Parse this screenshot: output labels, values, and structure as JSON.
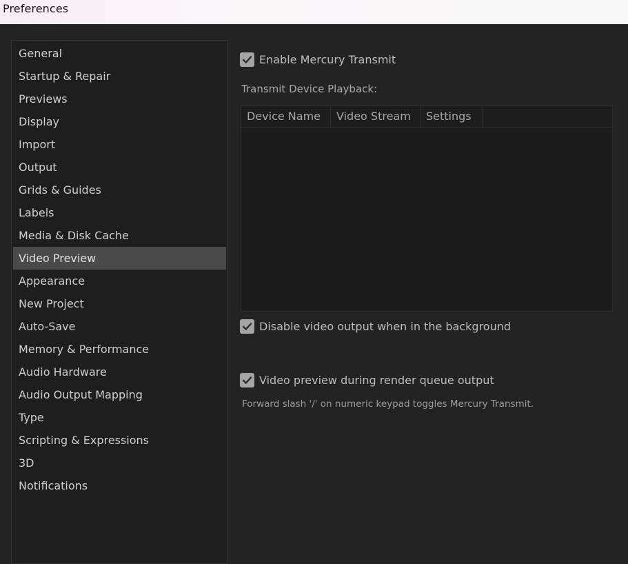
{
  "window": {
    "title": "Preferences"
  },
  "sidebar": {
    "selected": "Video Preview",
    "items": [
      {
        "label": "General"
      },
      {
        "label": "Startup & Repair"
      },
      {
        "label": "Previews"
      },
      {
        "label": "Display"
      },
      {
        "label": "Import"
      },
      {
        "label": "Output"
      },
      {
        "label": "Grids & Guides"
      },
      {
        "label": "Labels"
      },
      {
        "label": "Media & Disk Cache"
      },
      {
        "label": "Video Preview"
      },
      {
        "label": "Appearance"
      },
      {
        "label": "New Project"
      },
      {
        "label": "Auto-Save"
      },
      {
        "label": "Memory & Performance"
      },
      {
        "label": "Audio Hardware"
      },
      {
        "label": "Audio Output Mapping"
      },
      {
        "label": "Type"
      },
      {
        "label": "Scripting & Expressions"
      },
      {
        "label": "3D"
      },
      {
        "label": "Notifications"
      }
    ]
  },
  "panel": {
    "enable_mercury": {
      "label": "Enable Mercury Transmit",
      "checked": true,
      "icon": "checkmark-icon"
    },
    "transmit_label": "Transmit Device Playback:",
    "table": {
      "columns": [
        "Device Name",
        "Video Stream",
        "Settings"
      ],
      "rows": []
    },
    "disable_bg": {
      "label": "Disable video output when in the background",
      "checked": true,
      "icon": "checkmark-icon"
    },
    "render_queue": {
      "label": "Video preview during render queue output",
      "checked": true,
      "icon": "checkmark-icon"
    },
    "note": "Forward slash '/' on numeric keypad toggles Mercury Transmit."
  },
  "colors": {
    "background": "#232323",
    "sidebar_bg": "#1e1e1e",
    "selected_bg": "#4a4a4a",
    "checkbox": "#a5a5a5"
  }
}
